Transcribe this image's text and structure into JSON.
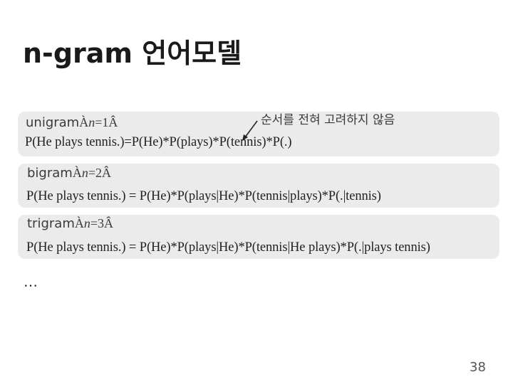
{
  "slide": {
    "title": "n-gram 언어모델",
    "note": "순서를 전혀 고려하지 않음",
    "ellipsis": "…",
    "page_number": "38"
  },
  "models": [
    {
      "name": "unigram",
      "open_mark": "À",
      "n_var": "n",
      "n_value": "=1",
      "close_mark": "Â",
      "formula": "P(He plays  tennis.)=P(He)*P(plays)*P(tennis)*P(.)"
    },
    {
      "name": "bigram",
      "open_mark": "À",
      "n_var": "n",
      "n_value": "=2",
      "close_mark": "Â",
      "formula": "P(He plays  tennis.) = P(He)*P(plays|He)*P(tennis|plays)*P(.|tennis)"
    },
    {
      "name": "trigram",
      "open_mark": "À",
      "n_var": "n",
      "n_value": "=3",
      "close_mark": "Â",
      "formula": "P(He plays  tennis.)  = P(He)*P(plays|He)*P(tennis|He  plays)*P(.|plays  tennis)"
    }
  ]
}
